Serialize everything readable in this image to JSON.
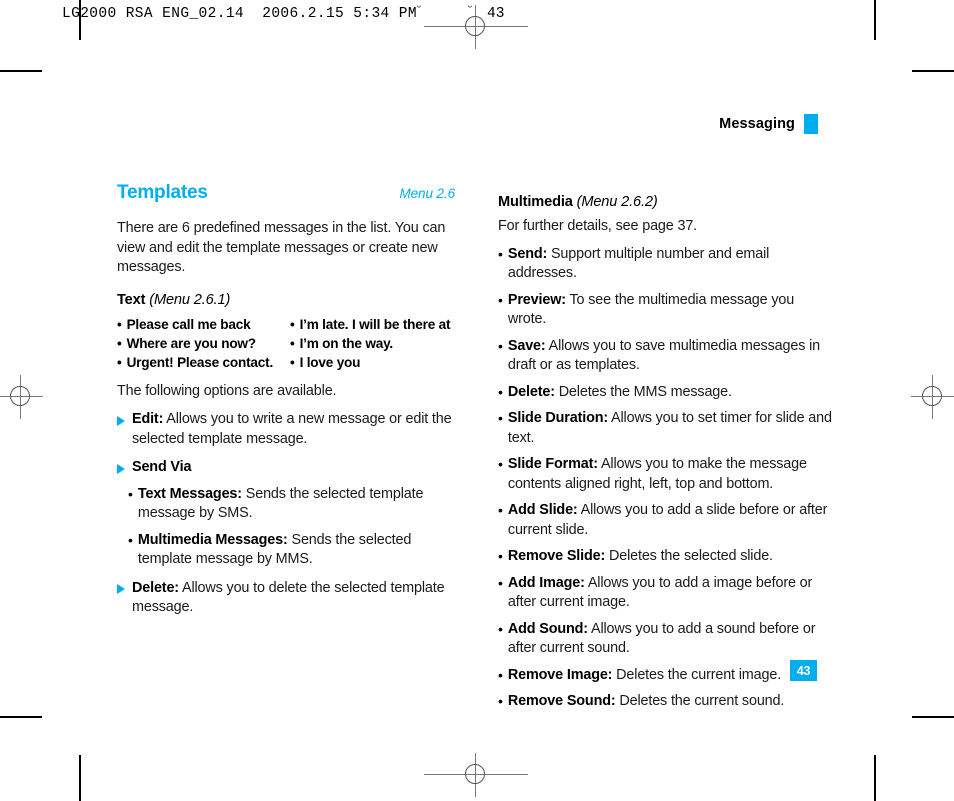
{
  "prepress": {
    "slug_line": "LG2000 RSA ENG_02.14  2006.2.15 5:34 PM",
    "mark_glyph_1": "˘",
    "mark_glyph_2": "˘",
    "slug_page": "43"
  },
  "running_head": {
    "title": "Messaging"
  },
  "accent_color": "#00aeef",
  "left_column": {
    "section": {
      "title": "Templates",
      "menu": "Menu 2.6"
    },
    "intro": "There are 6 predefined messages in the list. You can view and edit the template messages or create new messages.",
    "subsection": {
      "name": "Text",
      "menu": "(Menu 2.6.1)"
    },
    "templates_left": [
      "Please call me back",
      "Where are you now?",
      "Urgent! Please contact."
    ],
    "templates_right": [
      "I’m late. I will be there at",
      "I’m on the way.",
      "I love you"
    ],
    "options_intro": "The following options are available.",
    "options": [
      {
        "label": "Edit:",
        "text": " Allows you to write a new message or edit the selected template message."
      },
      {
        "label": "Send Via",
        "text": ""
      },
      {
        "label": "Delete:",
        "text": " Allows you to delete the selected template message."
      }
    ],
    "send_via_items": [
      {
        "label": "Text Messages:",
        "text": " Sends the selected template message by SMS."
      },
      {
        "label": "Multimedia Messages:",
        "text": " Sends the selected template message by MMS."
      }
    ]
  },
  "right_column": {
    "subsection": {
      "name": "Multimedia",
      "menu": "(Menu 2.6.2)"
    },
    "intro": "For further details, see page 37.",
    "items": [
      {
        "label": "Send:",
        "text": " Support multiple number and email addresses."
      },
      {
        "label": "Preview:",
        "text": " To see the multimedia message you wrote."
      },
      {
        "label": "Save:",
        "text": " Allows you to save multimedia messages in draft or as templates."
      },
      {
        "label": "Delete:",
        "text": " Deletes the MMS message."
      },
      {
        "label": "Slide Duration:",
        "text": " Allows you to set timer for slide and text."
      },
      {
        "label": "Slide Format:",
        "text": " Allows you to make the message contents aligned right, left, top and bottom."
      },
      {
        "label": "Add Slide:",
        "text": " Allows you to add a slide before or after current slide."
      },
      {
        "label": "Remove Slide:",
        "text": " Deletes the selected slide."
      },
      {
        "label": "Add Image:",
        "text": " Allows you to add a image before or after current image."
      },
      {
        "label": "Add Sound:",
        "text": " Allows you to add a sound before or after current sound."
      },
      {
        "label": "Remove Image:",
        "text": " Deletes the current image."
      },
      {
        "label": "Remove Sound:",
        "text": " Deletes the current sound."
      }
    ]
  },
  "footer": {
    "page_number": "43"
  },
  "bullet_glyphs": {
    "dot": "•"
  }
}
